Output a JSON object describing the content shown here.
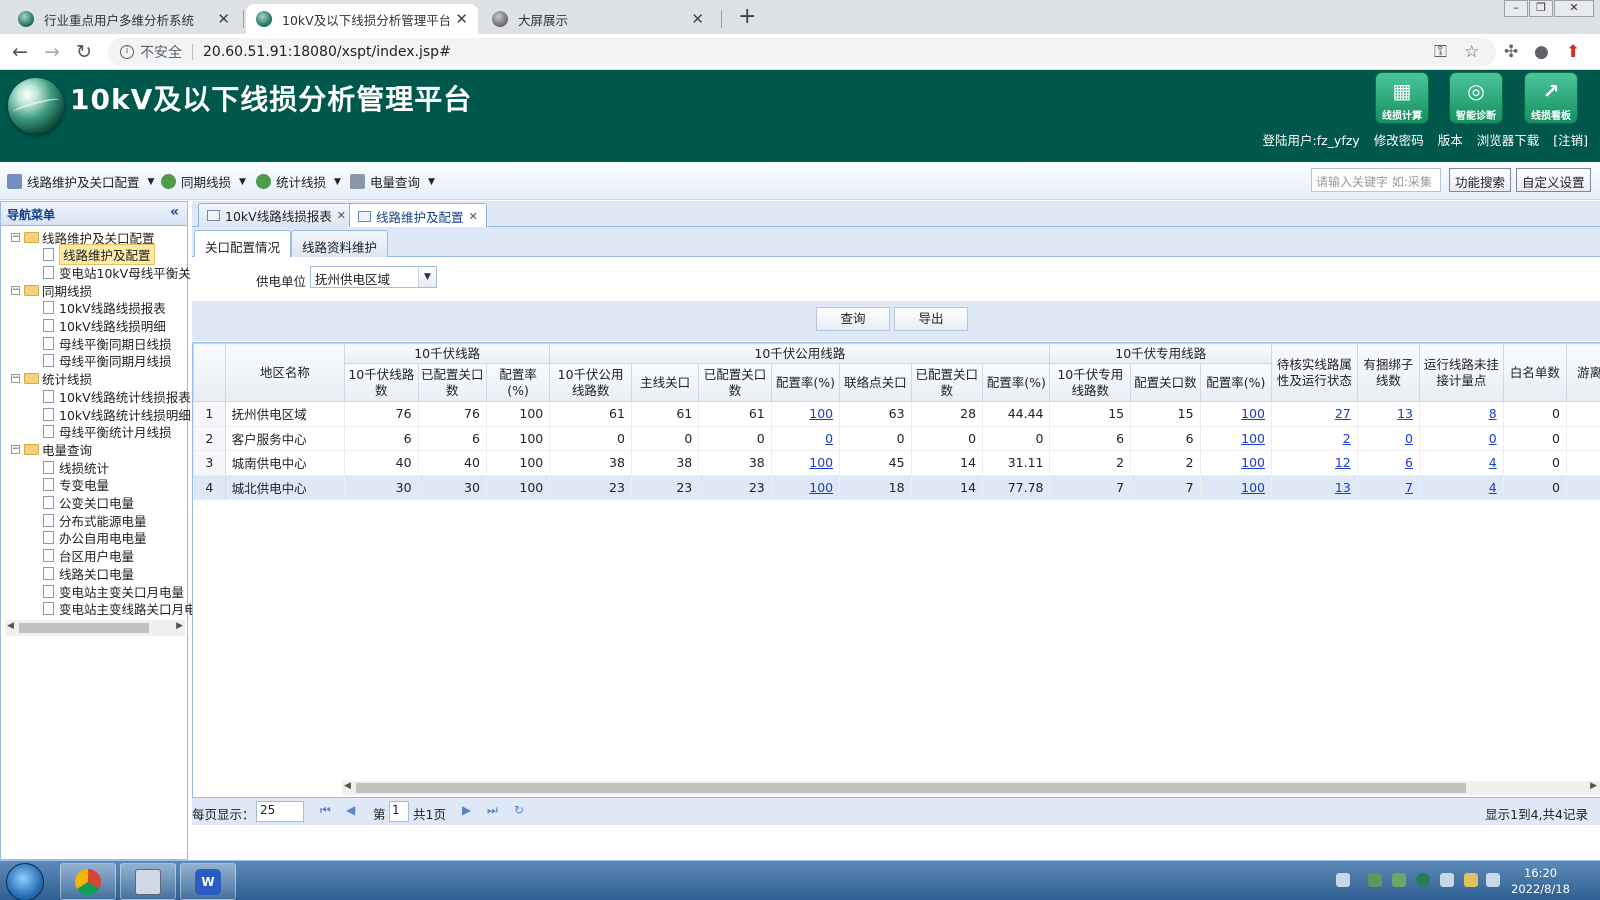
{
  "browser": {
    "tabs": [
      {
        "title": "行业重点用户多维分析系统",
        "active": false
      },
      {
        "title": "10kV及以下线损分析管理平台",
        "active": true
      },
      {
        "title": "大屏展示",
        "active": false
      }
    ],
    "new_tab": "+",
    "insecure_label": "不安全",
    "url": "20.60.51.91:18080/xspt/index.jsp#"
  },
  "app": {
    "title": "10kV及以下线损分析管理平台",
    "header_buttons": [
      {
        "label": "线损计算",
        "icon": "calculator-icon"
      },
      {
        "label": "智能诊断",
        "icon": "diagnosis-icon"
      },
      {
        "label": "线损看板",
        "icon": "chart-board-icon"
      }
    ],
    "user_links": {
      "login_user": "登陆用户:fz_yfzy",
      "change_password": "修改密码",
      "version": "版本",
      "browser_download": "浏览器下载",
      "logout": "[注销]"
    }
  },
  "menubar": {
    "items": [
      "线路维护及关口配置",
      "同期线损",
      "统计线损",
      "电量查询"
    ],
    "search_placeholder": "请输入关键字 如:采集",
    "search_button": "功能搜索",
    "custom_button": "自定义设置"
  },
  "nav": {
    "title": "导航菜单",
    "tree": [
      {
        "label": "线路维护及关口配置",
        "children": [
          "线路维护及配置",
          "变电站10kV母线平衡关"
        ]
      },
      {
        "label": "同期线损",
        "children": [
          "10kV线路线损报表",
          "10kV线路线损明细",
          "母线平衡同期日线损",
          "母线平衡同期月线损"
        ]
      },
      {
        "label": "统计线损",
        "children": [
          "10kV线路统计线损报表",
          "10kV线路统计线损明细",
          "母线平衡统计月线损"
        ]
      },
      {
        "label": "电量查询",
        "children": [
          "线损统计",
          "专变电量",
          "公变关口电量",
          "分布式能源电量",
          "办公自用电电量",
          "台区用户电量",
          "线路关口电量",
          "变电站主变关口月电量",
          "变电站主变线路关口月电"
        ]
      }
    ],
    "selected": "线路维护及配置"
  },
  "content_tabs": [
    {
      "title": "10kV线路线损报表",
      "active": false
    },
    {
      "title": "线路维护及配置",
      "active": true
    }
  ],
  "sub_tabs": [
    {
      "title": "关口配置情况",
      "active": true
    },
    {
      "title": "线路资料维护",
      "active": false
    }
  ],
  "filter": {
    "label": "供电单位",
    "value": "抚州供电区域"
  },
  "actions": {
    "query": "查询",
    "export": "导出"
  },
  "grid": {
    "group_headers": {
      "area": "地区名称",
      "g1": "10千伏线路",
      "g2": "10千伏公用线路",
      "g3": "10千伏专用线路",
      "pending": "待核实线路属性及运行状态",
      "bundled": "有捆绑子线数",
      "unmetered": "运行线路未挂接计量点",
      "whitelist": "白名单数",
      "free": "游离"
    },
    "sub_headers": {
      "g1": [
        "10千伏线路数",
        "已配置关口数",
        "配置率(%)"
      ],
      "g2": [
        "10千伏公用线路数",
        "主线关口",
        "已配置关口数",
        "配置率(%)",
        "联络点关口",
        "已配置关口数",
        "配置率(%)"
      ],
      "g3": [
        "10千伏专用线路数",
        "配置关口数",
        "配置率(%)"
      ]
    },
    "rows": [
      {
        "no": "1",
        "area": "抚州供电区域",
        "c": [
          "76",
          "76",
          "100",
          "61",
          "61",
          "61",
          "100",
          "63",
          "28",
          "44.44",
          "15",
          "15",
          "100",
          "27",
          "13",
          "8",
          "0"
        ],
        "highlight": false
      },
      {
        "no": "2",
        "area": "客户服务中心",
        "c": [
          "6",
          "6",
          "100",
          "0",
          "0",
          "0",
          "0",
          "0",
          "0",
          "0",
          "6",
          "6",
          "100",
          "2",
          "0",
          "0",
          "0"
        ],
        "highlight": false
      },
      {
        "no": "3",
        "area": "城南供电中心",
        "c": [
          "40",
          "40",
          "100",
          "38",
          "38",
          "38",
          "100",
          "45",
          "14",
          "31.11",
          "2",
          "2",
          "100",
          "12",
          "6",
          "4",
          "0"
        ],
        "highlight": false
      },
      {
        "no": "4",
        "area": "城北供电中心",
        "c": [
          "30",
          "30",
          "100",
          "23",
          "23",
          "23",
          "100",
          "18",
          "14",
          "77.78",
          "7",
          "7",
          "100",
          "13",
          "7",
          "4",
          "0"
        ],
        "highlight": true
      }
    ]
  },
  "pager": {
    "page_size_label": "每页显示：",
    "page_size": "25",
    "page_prefix": "第",
    "page_current": "1",
    "page_total": "共1页",
    "summary": "显示1到4,共4记录"
  },
  "taskbar": {
    "time": "16:20",
    "date": "2022/8/18"
  }
}
